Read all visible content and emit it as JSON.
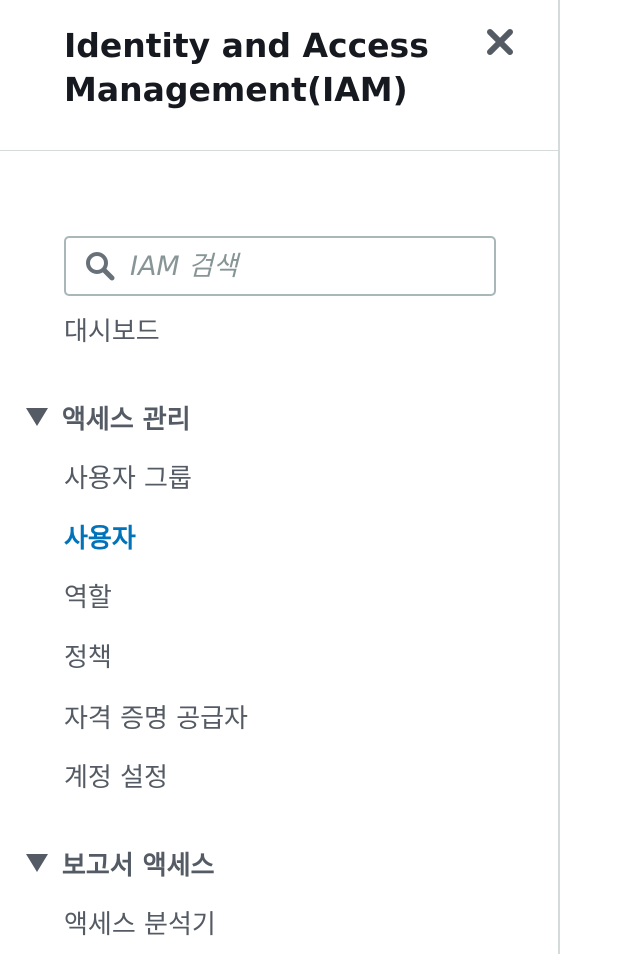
{
  "header": {
    "title": "Identity and Access Management(IAM)",
    "close_icon": "close-icon"
  },
  "search": {
    "placeholder": "IAM 검색",
    "value": "",
    "icon": "search-icon"
  },
  "nav": {
    "dashboard": "대시보드",
    "access_management": {
      "label": "액세스 관리",
      "expanded": true,
      "items": [
        "사용자 그룹",
        "사용자",
        "역할",
        "정책",
        "자격 증명 공급자",
        "계정 설정"
      ],
      "active": "사용자"
    },
    "access_reports": {
      "label": "보고서 액세스",
      "expanded": true,
      "items": [
        "액세스 분석기"
      ]
    }
  },
  "colors": {
    "active_link": "#0073bb",
    "text": "#545b64",
    "title": "#16191f",
    "border": "#d5dbdb"
  }
}
